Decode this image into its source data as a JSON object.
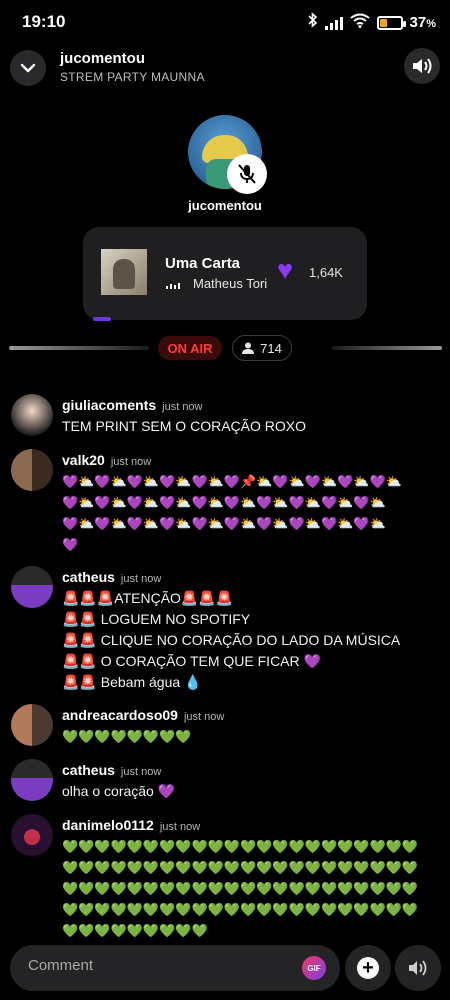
{
  "status_bar": {
    "time": "19:10",
    "battery_percent": "37",
    "battery_level": 0.37,
    "battery_color": "#f5a400",
    "icons": [
      "bluetooth-icon",
      "signal-icon",
      "wifi-icon",
      "battery-icon"
    ]
  },
  "header": {
    "title": "jucomentou",
    "subtitle": "STREM PARTY MAUNNA",
    "back_icon": "chevron-down-icon",
    "sound_icon": "speaker-icon"
  },
  "host": {
    "name": "jucomentou",
    "mute_icon": "mic-off-icon"
  },
  "music": {
    "title": "Uma Carta",
    "artist": "Matheus Tori",
    "like_count": "1,64K",
    "like_color": "#8c3cf0"
  },
  "live": {
    "on_air_label": "ON AIR",
    "viewers": "714",
    "on_air_color": "#ff3b3b"
  },
  "chat": {
    "messages": [
      {
        "user": "giuliacoments",
        "time": "just now",
        "lines": [
          "TEM PRINT SEM O CORAÇÃO ROXO"
        ]
      },
      {
        "user": "valk20",
        "time": "just now",
        "lines": [
          "💜⛅💜⛅💜⛅💜⛅💜⛅💜📌⛅💜⛅💜⛅💜⛅💜⛅",
          "💜⛅💜⛅💜⛅💜⛅💜⛅💜⛅💜⛅💜⛅💜⛅💜⛅",
          "💜⛅💜⛅💜⛅💜⛅💜⛅💜⛅💜⛅💜⛅💜⛅💜⛅",
          "💜"
        ]
      },
      {
        "user": "catheus",
        "time": "just now",
        "lines": [
          "🚨🚨🚨ATENÇÃO🚨🚨🚨",
          "🚨🚨 LOGUEM NO SPOTIFY",
          "🚨🚨 CLIQUE NO CORAÇÃO DO LADO DA MÚSICA",
          "🚨🚨 O CORAÇÃO TEM QUE FICAR 💜",
          "🚨🚨 Bebam água 💧"
        ]
      },
      {
        "user": "andreacardoso09",
        "time": "just now",
        "lines": [
          "💚💚💚💚💚💚💚💚"
        ]
      },
      {
        "user": "catheus",
        "time": "just now",
        "lines": [
          "olha o coração   💜"
        ]
      },
      {
        "user": "danimelo0112",
        "time": "just now",
        "lines": [
          "💚💚💚💚💚💚💚💚💚💚💚💚💚💚💚💚💚💚💚💚💚💚",
          "💚💚💚💚💚💚💚💚💚💚💚💚💚💚💚💚💚💚💚💚💚💚",
          "💚💚💚💚💚💚💚💚💚💚💚💚💚💚💚💚💚💚💚💚💚💚",
          "💚💚💚💚💚💚💚💚💚💚💚💚💚💚💚💚💚💚💚💚💚💚",
          "💚💚💚💚💚💚💚💚💚"
        ]
      }
    ]
  },
  "composer": {
    "placeholder": "Comment",
    "gif_label": "GIF",
    "add_icon": "plus-icon",
    "speaker_icon": "speaker-icon"
  }
}
